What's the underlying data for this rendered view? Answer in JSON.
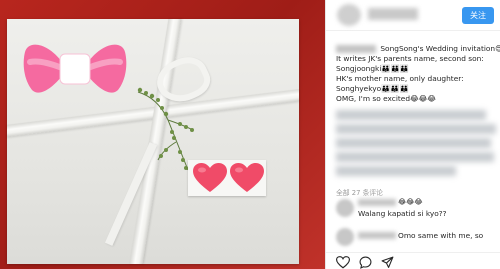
{
  "post": {
    "image_alt": "wedding invitation photo",
    "follow_label": "关注",
    "caption_lines": [
      "SongSong's Wedding invitation😍😍😍",
      "It writes JK's parents name, second son:",
      "Songjoongki👪👪👪",
      "HK's mother name, only daughter:",
      "Songhyekyo👪👪👪",
      "OMG, I'm so excited😂😂😂"
    ],
    "comment_count_label": "全部 27 条评论",
    "comments": [
      {
        "user_suffix": "😂😂😂",
        "text": "Walang kapatid si kyo??"
      },
      {
        "user_suffix": "",
        "text": "Omo same with me, so"
      }
    ]
  },
  "colors": {
    "follow": "#3897f0",
    "bow_pink": "#f56aa0",
    "heart": "#f04b68",
    "background_red": "#b8261e"
  },
  "icons": [
    "heart-icon",
    "comment-icon",
    "share-icon"
  ]
}
